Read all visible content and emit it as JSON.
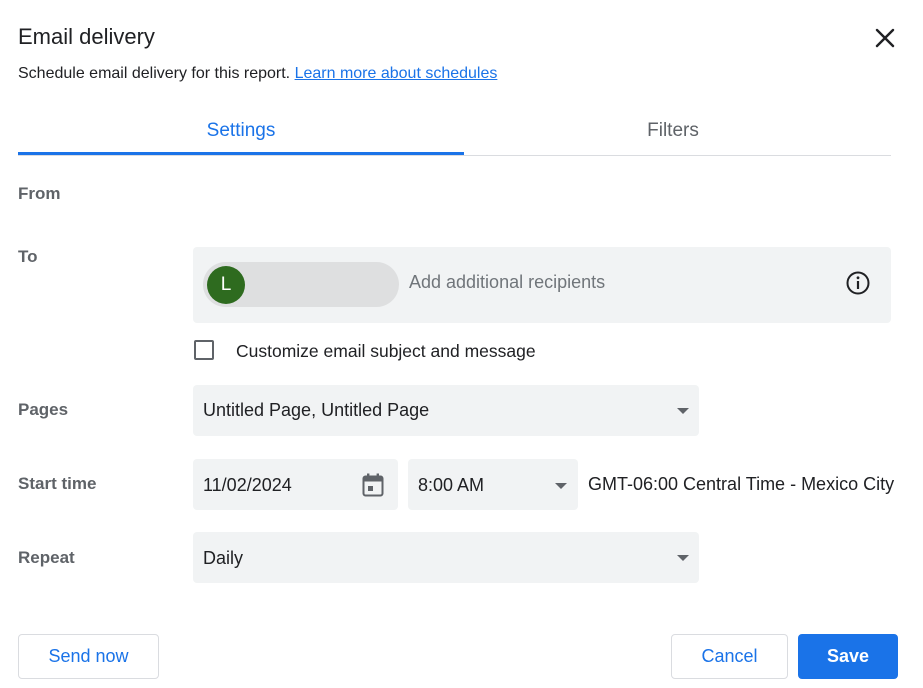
{
  "dialog": {
    "title": "Email delivery",
    "subtitle": "Schedule email delivery for this report.",
    "learn_more_link": "Learn more about schedules"
  },
  "tabs": [
    {
      "label": "Settings",
      "active": true
    },
    {
      "label": "Filters",
      "active": false
    }
  ],
  "form": {
    "from_label": "From",
    "to_label": "To",
    "recipient_avatar_initial": "L",
    "recipients_placeholder": "Add additional recipients",
    "customize_label": "Customize email subject and message",
    "customize_checked": false,
    "pages_label": "Pages",
    "pages_value": "Untitled Page, Untitled Page",
    "start_time_label": "Start time",
    "start_date": "11/02/2024",
    "start_time": "8:00 AM",
    "timezone": "GMT-06:00 Central Time - Mexico City",
    "repeat_label": "Repeat",
    "repeat_value": "Daily"
  },
  "footer": {
    "send_now": "Send now",
    "cancel": "Cancel",
    "save": "Save"
  },
  "colors": {
    "accent": "#1a73e8",
    "avatar": "#2e6b1f",
    "field_bg": "#f1f3f4"
  }
}
